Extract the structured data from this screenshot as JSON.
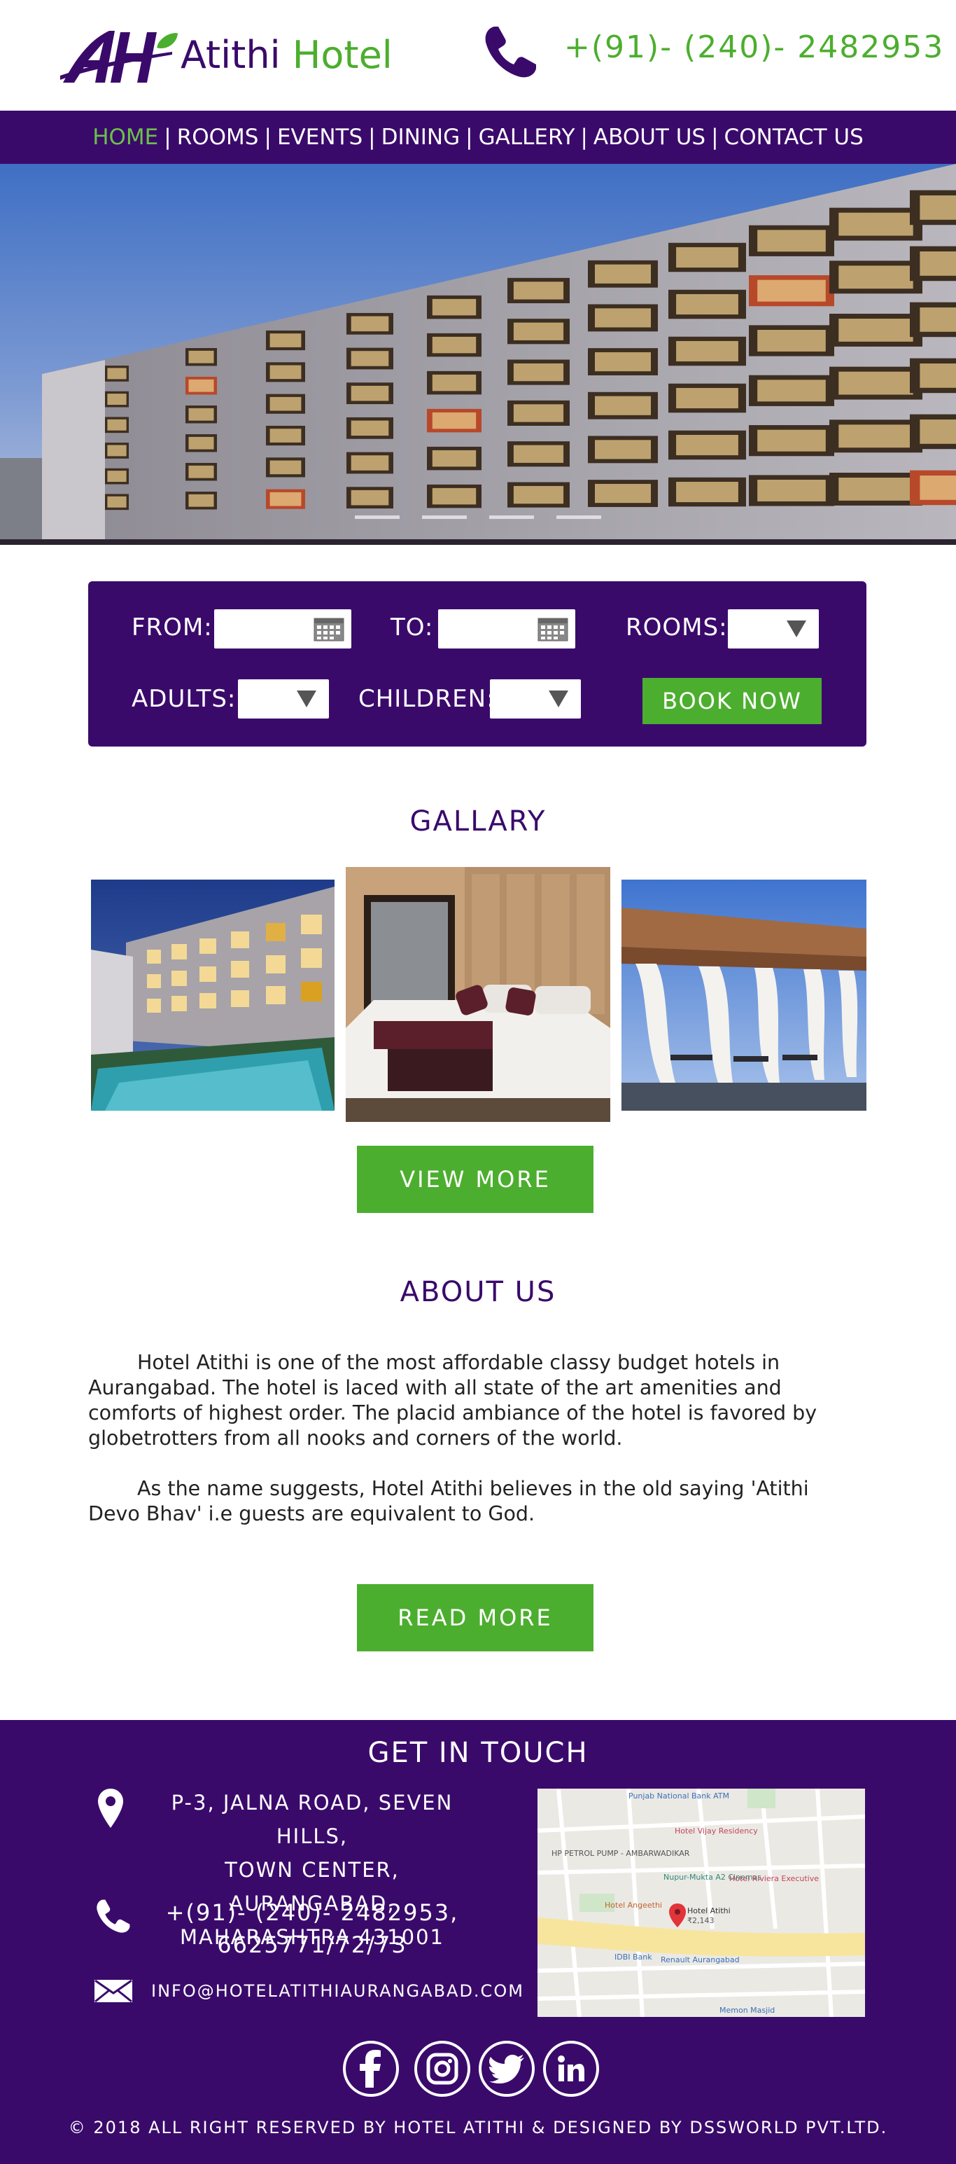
{
  "header": {
    "logo_initials": "AH",
    "logo_word1": "Atithi",
    "logo_word2": "Hotel",
    "phone": "+(91)- (240)- 2482953"
  },
  "nav": {
    "items": [
      "HOME",
      "ROOMS",
      "EVENTS",
      "DINING",
      "GALLERY",
      "ABOUT US",
      "CONTACT US"
    ],
    "active": "HOME"
  },
  "booking": {
    "from_label": "FROM:",
    "to_label": "TO:",
    "rooms_label": "ROOMS:",
    "adults_label": "ADULTS:",
    "children_label": "CHILDREN:",
    "book_label": "BOOK NOW"
  },
  "gallery": {
    "title": "GALLARY",
    "view_more": "VIEW MORE"
  },
  "about": {
    "title": "ABOUT US",
    "p1": "Hotel Atithi is one of the most affordable classy budget hotels in Aurangabad. The hotel is laced with all state of the art amenities and comforts of highest order. The placid ambiance of the hotel is favored by globetrotters from all nooks and corners of the world.",
    "p2": "As the name suggests, Hotel Atithi believes in the old saying 'Atithi Devo Bhav' i.e guests are equivalent to God.",
    "read_more": "READ MORE"
  },
  "footer": {
    "title": "GET IN TOUCH",
    "address_line1": "P-3, JALNA ROAD, SEVEN HILLS,",
    "address_line2": "TOWN CENTER, AURANGABAD,",
    "address_line3": "MAHARASHTRA 431001",
    "phone_line1": "+(91)- (240)- 2482953,",
    "phone_line2": "6625771/72/73",
    "email": "INFO@HOTELATITHIAURANGABAD.COM",
    "map_labels": {
      "pnb": "Punjab National Bank ATM",
      "vijay": "Hotel Vijay Residency",
      "petrol": "HP PETROL PUMP - AMBARWADIKAR",
      "nupur": "Nupur-Mukta A2 Cinemas",
      "riviera": "Hotel Riviera Executive",
      "angeethi": "Hotel Angeethi",
      "atithi": "Hotel Atithi",
      "price": "₹2,143",
      "idbi": "IDBI Bank",
      "renault": "Renault Aurangabad",
      "memon": "Memon Masjid"
    },
    "copyright": "© 2018 ALL RIGHT RESERVED BY HOTEL ATITHI & DESIGNED BY DSSWORLD PVT.LTD."
  },
  "colors": {
    "brand_purple": "#3a0a6b",
    "brand_green": "#4cae2e"
  }
}
